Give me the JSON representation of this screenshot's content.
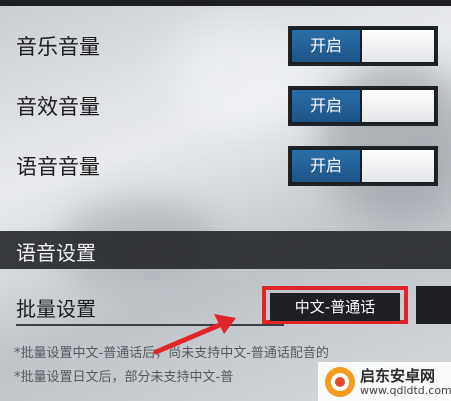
{
  "settings": {
    "music_volume": {
      "label": "音乐音量",
      "toggle_text": "开启"
    },
    "sfx_volume": {
      "label": "音效音量",
      "toggle_text": "开启"
    },
    "voice_volume": {
      "label": "语音音量",
      "toggle_text": "开启"
    }
  },
  "voice_section": {
    "title": "语音设置",
    "batch_label": "批量设置",
    "batch_value": "中文-普通话",
    "notes": [
      "*批量设置中文-普通话后，尚未支持中文-普通话配音的",
      "*批量设置日文后，部分未支持中文-普"
    ]
  },
  "watermark": {
    "name": "启东安卓网",
    "url": "www.qdldtd.com"
  },
  "colors": {
    "toggle_on": "#1d5488",
    "highlight": "#e0242a",
    "dark_panel": "#1e2024"
  }
}
